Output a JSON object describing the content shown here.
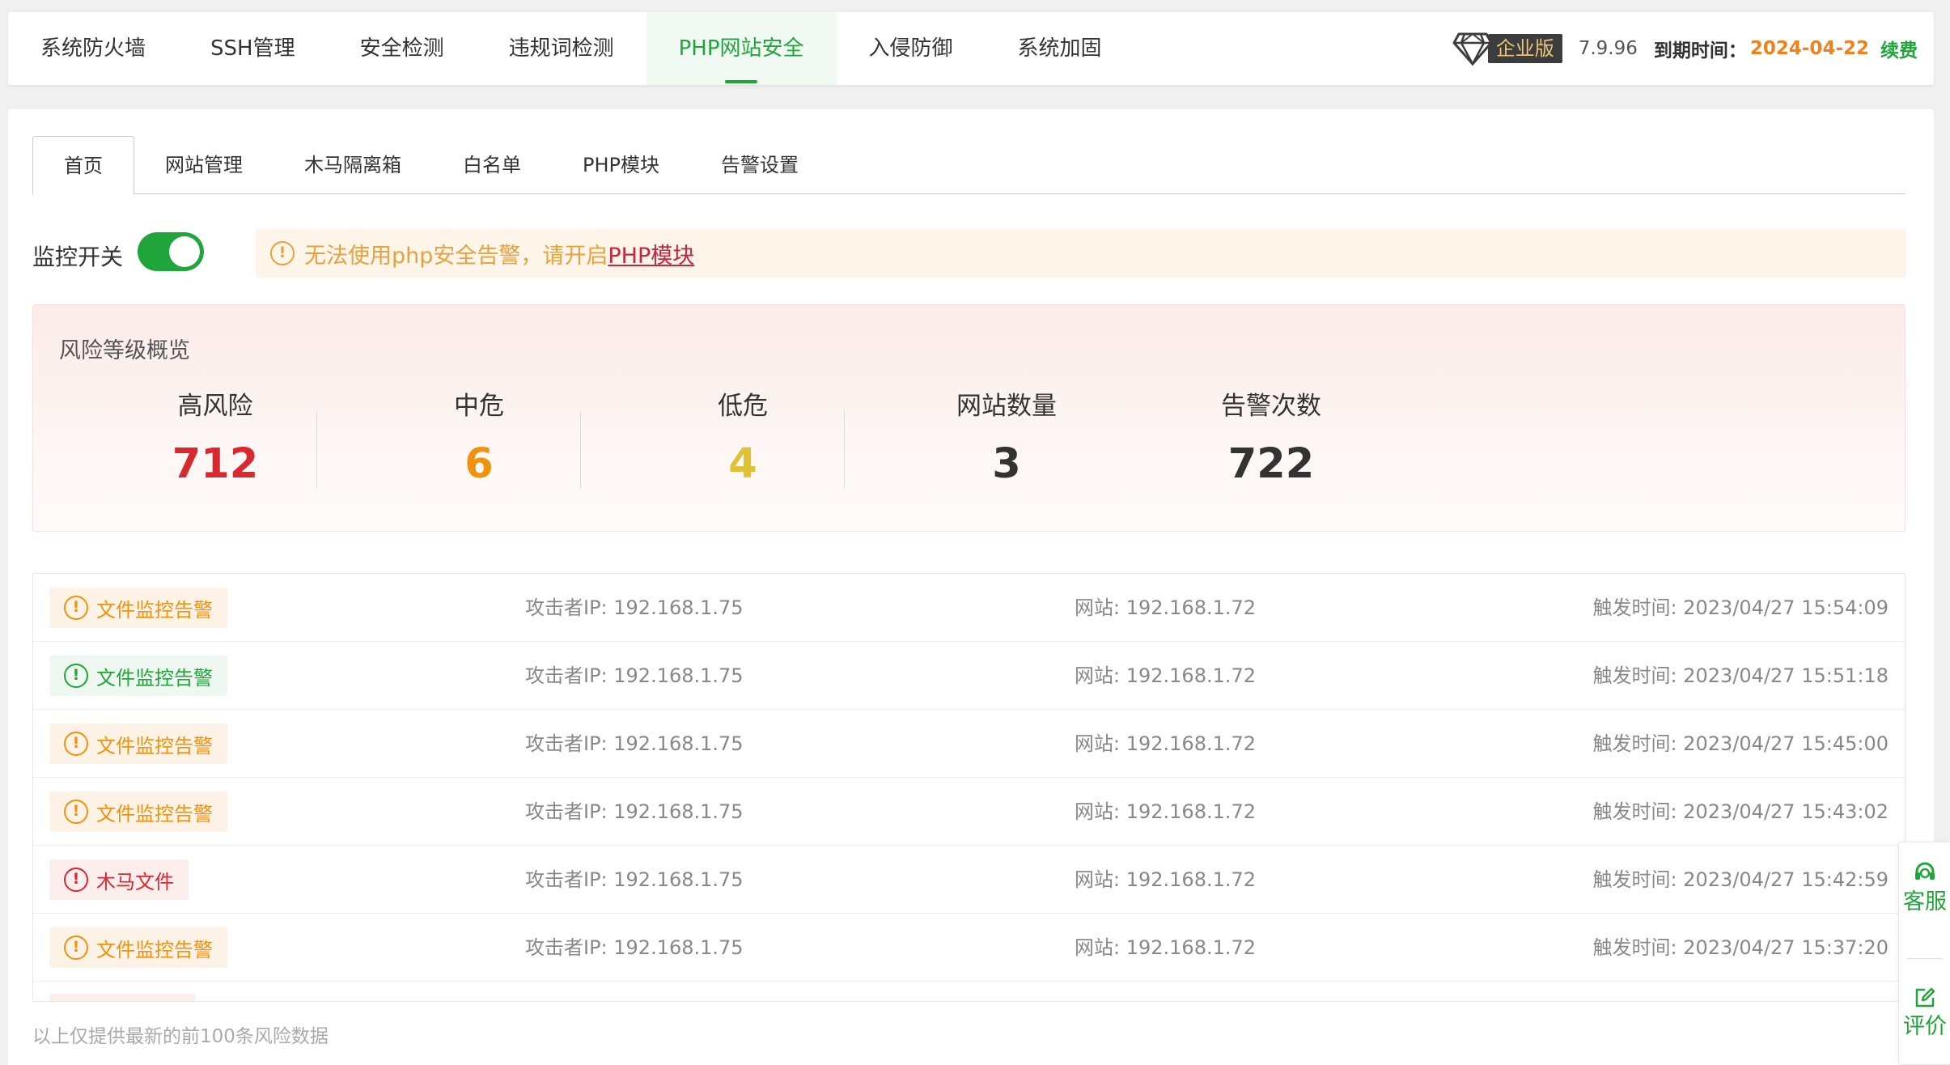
{
  "topnav": {
    "items": [
      {
        "label": "系统防火墙",
        "active": false
      },
      {
        "label": "SSH管理",
        "active": false
      },
      {
        "label": "安全检测",
        "active": false
      },
      {
        "label": "违规词检测",
        "active": false
      },
      {
        "label": "PHP网站安全",
        "active": true
      },
      {
        "label": "入侵防御",
        "active": false
      },
      {
        "label": "系统加固",
        "active": false
      }
    ],
    "edition": "企业版",
    "version": "7.9.96",
    "expire_label": "到期时间：",
    "expire_date": "2024-04-22",
    "renew": "续费"
  },
  "subtabs": [
    {
      "label": "首页",
      "active": true
    },
    {
      "label": "网站管理",
      "active": false
    },
    {
      "label": "木马隔离箱",
      "active": false
    },
    {
      "label": "白名单",
      "active": false
    },
    {
      "label": "PHP模块",
      "active": false
    },
    {
      "label": "告警设置",
      "active": false
    }
  ],
  "monitor": {
    "label": "监控开关",
    "enabled": true,
    "notice_text": "无法使用php安全告警，请开启",
    "notice_link": "PHP模块"
  },
  "overview": {
    "title": "风险等级概览",
    "stats": [
      {
        "label": "高风险",
        "value": "712",
        "color": "#d9282f"
      },
      {
        "label": "中危",
        "value": "6",
        "color": "#f0920e"
      },
      {
        "label": "低危",
        "value": "4",
        "color": "#e0c233"
      },
      {
        "label": "网站数量",
        "value": "3",
        "color": "#333333"
      },
      {
        "label": "告警次数",
        "value": "722",
        "color": "#333333"
      }
    ]
  },
  "alerts": [
    {
      "type": "文件监控告警",
      "level": "orange",
      "attacker": "攻击者IP: 192.168.1.75",
      "site": "网站: 192.168.1.72",
      "time": "触发时间: 2023/04/27 15:54:09"
    },
    {
      "type": "文件监控告警",
      "level": "green",
      "attacker": "攻击者IP: 192.168.1.75",
      "site": "网站: 192.168.1.72",
      "time": "触发时间: 2023/04/27 15:51:18"
    },
    {
      "type": "文件监控告警",
      "level": "orange",
      "attacker": "攻击者IP: 192.168.1.75",
      "site": "网站: 192.168.1.72",
      "time": "触发时间: 2023/04/27 15:45:00"
    },
    {
      "type": "文件监控告警",
      "level": "orange",
      "attacker": "攻击者IP: 192.168.1.75",
      "site": "网站: 192.168.1.72",
      "time": "触发时间: 2023/04/27 15:43:02"
    },
    {
      "type": "木马文件",
      "level": "red",
      "attacker": "攻击者IP: 192.168.1.75",
      "site": "网站: 192.168.1.72",
      "time": "触发时间: 2023/04/27 15:42:59"
    },
    {
      "type": "文件监控告警",
      "level": "orange",
      "attacker": "攻击者IP: 192.168.1.75",
      "site": "网站: 192.168.1.72",
      "time": "触发时间: 2023/04/27 15:37:20"
    }
  ],
  "footnote": "以上仅提供最新的前100条风险数据",
  "sidepanel": {
    "service": "客服",
    "review": "评价"
  },
  "colors": {
    "accent": "#20a53a",
    "high": "#d9282f",
    "medium": "#f0920e",
    "low": "#e0c233"
  }
}
